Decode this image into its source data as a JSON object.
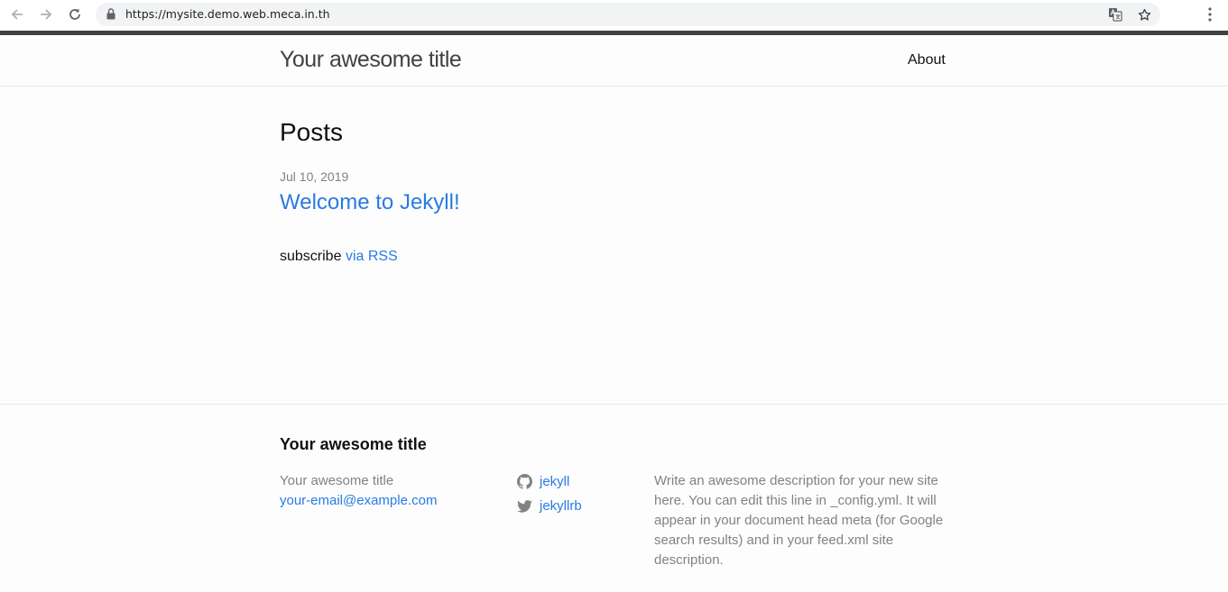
{
  "browser": {
    "url": "https://mysite.demo.web.meca.in.th",
    "icons": [
      "back-arrow-icon",
      "forward-arrow-icon",
      "reload-icon",
      "lock-icon",
      "translate-icon",
      "star-icon",
      "kebab-menu-icon"
    ]
  },
  "header": {
    "site_title": "Your awesome title",
    "nav": [
      {
        "label": "About"
      }
    ]
  },
  "main": {
    "heading": "Posts",
    "posts": [
      {
        "date": "Jul 10, 2019",
        "title": "Welcome to Jekyll!"
      }
    ],
    "rss_prefix": "subscribe",
    "rss_link": "via RSS"
  },
  "footer": {
    "heading": "Your awesome title",
    "contact_name": "Your awesome title",
    "email": "your-email@example.com",
    "social": [
      {
        "icon": "github-icon",
        "label": "jekyll"
      },
      {
        "icon": "twitter-icon",
        "label": "jekyllrb"
      }
    ],
    "description": "Write an awesome description for your new site here. You can edit this line in _config.yml. It will appear in your document head meta (for Google search results) and in your feed.xml site description."
  },
  "colors": {
    "link": "#2a7ae2",
    "text": "#111111",
    "muted": "#828282",
    "chrome_border": "#424242"
  }
}
